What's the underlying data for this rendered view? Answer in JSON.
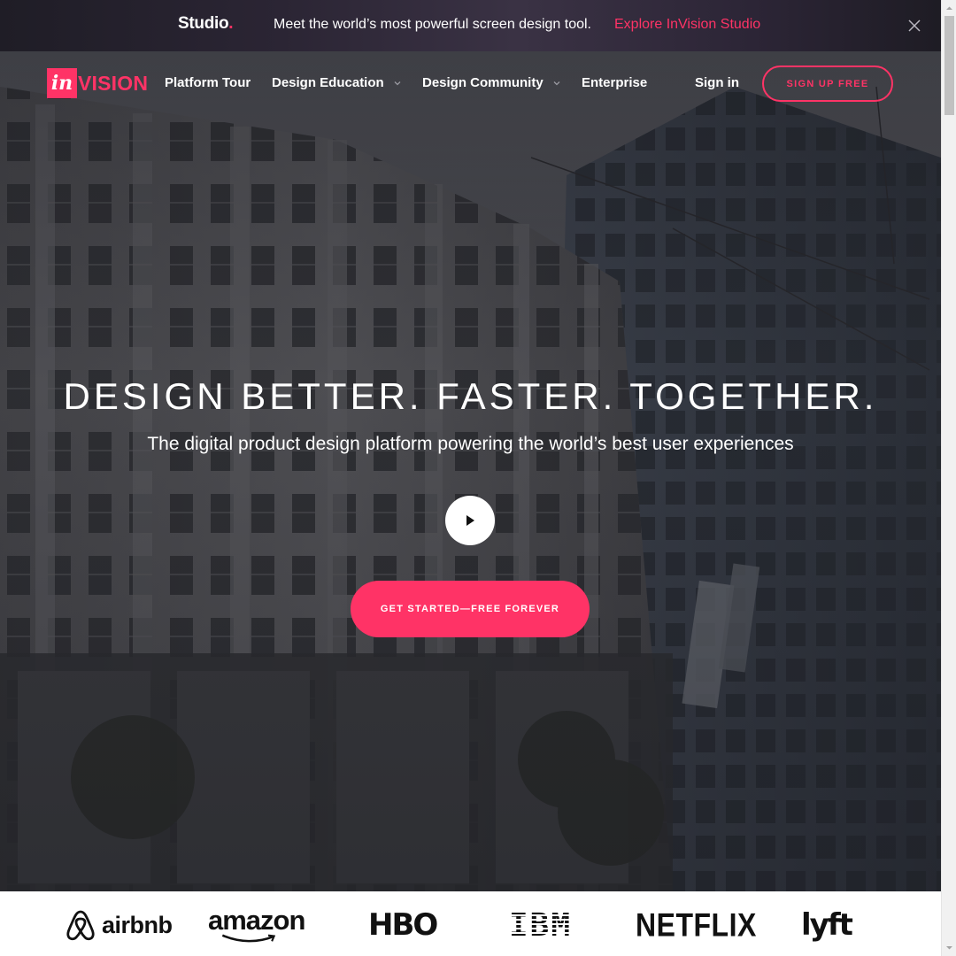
{
  "promo": {
    "logo": "Studio",
    "logo_dot": ".",
    "text": "Meet the world’s most powerful screen design tool.",
    "link": "Explore InVision Studio"
  },
  "nav": {
    "logo_mark": "in",
    "logo_text": "VISION",
    "items": [
      {
        "label": "Platform Tour",
        "dropdown": false
      },
      {
        "label": "Design Education",
        "dropdown": true
      },
      {
        "label": "Design Community",
        "dropdown": true
      },
      {
        "label": "Enterprise",
        "dropdown": false
      }
    ],
    "sign_in": "Sign in",
    "sign_up": "SIGN UP FREE"
  },
  "hero": {
    "title": "DESIGN BETTER. FASTER. TOGETHER.",
    "subtitle": "The digital product design platform powering the world’s best user experiences",
    "cta": "GET STARTED—FREE FOREVER"
  },
  "clients": [
    "airbnb",
    "amazon",
    "HBO",
    "IBM",
    "NETFLIX",
    "lyft"
  ],
  "colors": {
    "brand": "#ff3366",
    "banner_bg": "#2b2534",
    "text_light": "#ffffff"
  },
  "icons": [
    "close-icon",
    "chevron-down-icon",
    "play-icon"
  ]
}
